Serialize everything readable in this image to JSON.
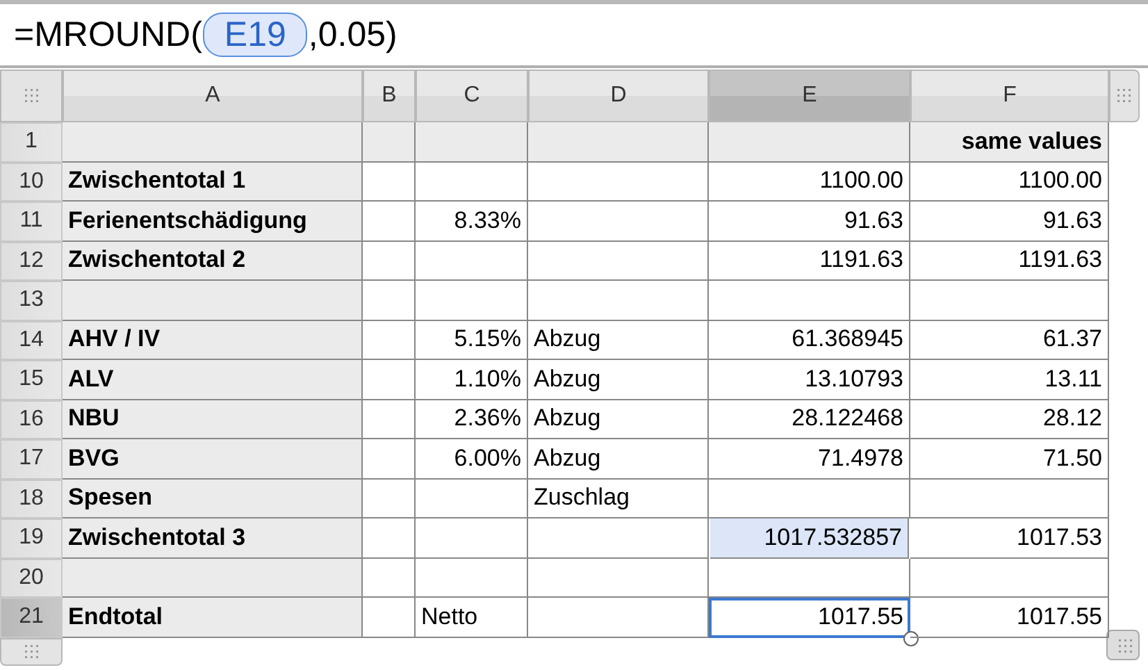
{
  "formula_bar": {
    "parts": [
      {
        "kind": "text",
        "text": "=MROUND("
      },
      {
        "kind": "reference",
        "text": "E19"
      },
      {
        "kind": "text",
        "text": ",0.05)"
      }
    ]
  },
  "columns": [
    {
      "label": "A",
      "selected": false
    },
    {
      "label": "B",
      "selected": false
    },
    {
      "label": "C",
      "selected": false
    },
    {
      "label": "D",
      "selected": false
    },
    {
      "label": "E",
      "selected": true
    },
    {
      "label": "F",
      "selected": false
    }
  ],
  "rows": [
    {
      "number": "1",
      "selected": false,
      "kind": "header",
      "cells": [
        {
          "selected": false,
          "referenced": false
        },
        {
          "selected": false,
          "referenced": false
        },
        {
          "selected": false,
          "referenced": false
        },
        {
          "selected": false,
          "referenced": false
        },
        {
          "selected": false,
          "referenced": false
        },
        {
          "text": "same values",
          "selected": false,
          "referenced": false
        }
      ]
    },
    {
      "number": "10",
      "selected": false,
      "kind": "body",
      "cells": [
        {
          "text": "Zwischentotal 1",
          "selected": false,
          "referenced": false
        },
        {
          "selected": false,
          "referenced": false
        },
        {
          "selected": false,
          "referenced": false
        },
        {
          "selected": false,
          "referenced": false
        },
        {
          "text": "1100.00",
          "selected": false,
          "referenced": false
        },
        {
          "text": "1100.00",
          "selected": false,
          "referenced": false
        }
      ]
    },
    {
      "number": "11",
      "selected": false,
      "kind": "body",
      "cells": [
        {
          "text": "Ferienentschädigung",
          "selected": false,
          "referenced": false
        },
        {
          "selected": false,
          "referenced": false
        },
        {
          "text": "8.33%",
          "selected": false,
          "referenced": false
        },
        {
          "selected": false,
          "referenced": false
        },
        {
          "text": "91.63",
          "selected": false,
          "referenced": false
        },
        {
          "text": "91.63",
          "selected": false,
          "referenced": false
        }
      ]
    },
    {
      "number": "12",
      "selected": false,
      "kind": "body",
      "cells": [
        {
          "text": "Zwischentotal 2",
          "selected": false,
          "referenced": false
        },
        {
          "selected": false,
          "referenced": false
        },
        {
          "selected": false,
          "referenced": false
        },
        {
          "selected": false,
          "referenced": false
        },
        {
          "text": "1191.63",
          "selected": false,
          "referenced": false
        },
        {
          "text": "1191.63",
          "selected": false,
          "referenced": false
        }
      ]
    },
    {
      "number": "13",
      "selected": false,
      "kind": "body",
      "cells": [
        {
          "selected": false,
          "referenced": false
        },
        {
          "selected": false,
          "referenced": false
        },
        {
          "selected": false,
          "referenced": false
        },
        {
          "selected": false,
          "referenced": false
        },
        {
          "selected": false,
          "referenced": false
        },
        {
          "selected": false,
          "referenced": false
        }
      ]
    },
    {
      "number": "14",
      "selected": false,
      "kind": "body",
      "cells": [
        {
          "text": "AHV / IV",
          "selected": false,
          "referenced": false
        },
        {
          "selected": false,
          "referenced": false
        },
        {
          "text": "5.15%",
          "selected": false,
          "referenced": false
        },
        {
          "text": "Abzug",
          "selected": false,
          "referenced": false
        },
        {
          "text": "61.368945",
          "selected": false,
          "referenced": false
        },
        {
          "text": "61.37",
          "selected": false,
          "referenced": false
        }
      ]
    },
    {
      "number": "15",
      "selected": false,
      "kind": "body",
      "cells": [
        {
          "text": "ALV",
          "selected": false,
          "referenced": false
        },
        {
          "selected": false,
          "referenced": false
        },
        {
          "text": "1.10%",
          "selected": false,
          "referenced": false
        },
        {
          "text": "Abzug",
          "selected": false,
          "referenced": false
        },
        {
          "text": "13.10793",
          "selected": false,
          "referenced": false
        },
        {
          "text": "13.11",
          "selected": false,
          "referenced": false
        }
      ]
    },
    {
      "number": "16",
      "selected": false,
      "kind": "body",
      "cells": [
        {
          "text": "NBU",
          "selected": false,
          "referenced": false
        },
        {
          "selected": false,
          "referenced": false
        },
        {
          "text": "2.36%",
          "selected": false,
          "referenced": false
        },
        {
          "text": "Abzug",
          "selected": false,
          "referenced": false
        },
        {
          "text": "28.122468",
          "selected": false,
          "referenced": false
        },
        {
          "text": "28.12",
          "selected": false,
          "referenced": false
        }
      ]
    },
    {
      "number": "17",
      "selected": false,
      "kind": "body",
      "cells": [
        {
          "text": "BVG",
          "selected": false,
          "referenced": false
        },
        {
          "selected": false,
          "referenced": false
        },
        {
          "text": "6.00%",
          "selected": false,
          "referenced": false
        },
        {
          "text": "Abzug",
          "selected": false,
          "referenced": false
        },
        {
          "text": "71.4978",
          "selected": false,
          "referenced": false
        },
        {
          "text": "71.50",
          "selected": false,
          "referenced": false
        }
      ]
    },
    {
      "number": "18",
      "selected": false,
      "kind": "body",
      "cells": [
        {
          "text": "Spesen",
          "selected": false,
          "referenced": false
        },
        {
          "selected": false,
          "referenced": false
        },
        {
          "selected": false,
          "referenced": false
        },
        {
          "text": "Zuschlag",
          "selected": false,
          "referenced": false
        },
        {
          "selected": false,
          "referenced": false
        },
        {
          "selected": false,
          "referenced": false
        }
      ]
    },
    {
      "number": "19",
      "selected": false,
      "kind": "body",
      "cells": [
        {
          "text": "Zwischentotal 3",
          "selected": false,
          "referenced": false
        },
        {
          "selected": false,
          "referenced": false
        },
        {
          "selected": false,
          "referenced": false
        },
        {
          "selected": false,
          "referenced": false
        },
        {
          "text": "1017.532857",
          "selected": false,
          "referenced": true
        },
        {
          "text": "1017.53",
          "selected": false,
          "referenced": false
        }
      ]
    },
    {
      "number": "20",
      "selected": false,
      "kind": "body",
      "cells": [
        {
          "selected": false,
          "referenced": false
        },
        {
          "selected": false,
          "referenced": false
        },
        {
          "selected": false,
          "referenced": false
        },
        {
          "selected": false,
          "referenced": false
        },
        {
          "selected": false,
          "referenced": false
        },
        {
          "selected": false,
          "referenced": false
        }
      ]
    },
    {
      "number": "21",
      "selected": true,
      "kind": "body",
      "cells": [
        {
          "text": "Endtotal",
          "selected": false,
          "referenced": false
        },
        {
          "selected": false,
          "referenced": false
        },
        {
          "text": "Netto",
          "selected": false,
          "referenced": false
        },
        {
          "selected": false,
          "referenced": false
        },
        {
          "text": "1017.55",
          "selected": true,
          "referenced": false
        },
        {
          "text": "1017.55",
          "selected": false,
          "referenced": false
        }
      ]
    }
  ]
}
